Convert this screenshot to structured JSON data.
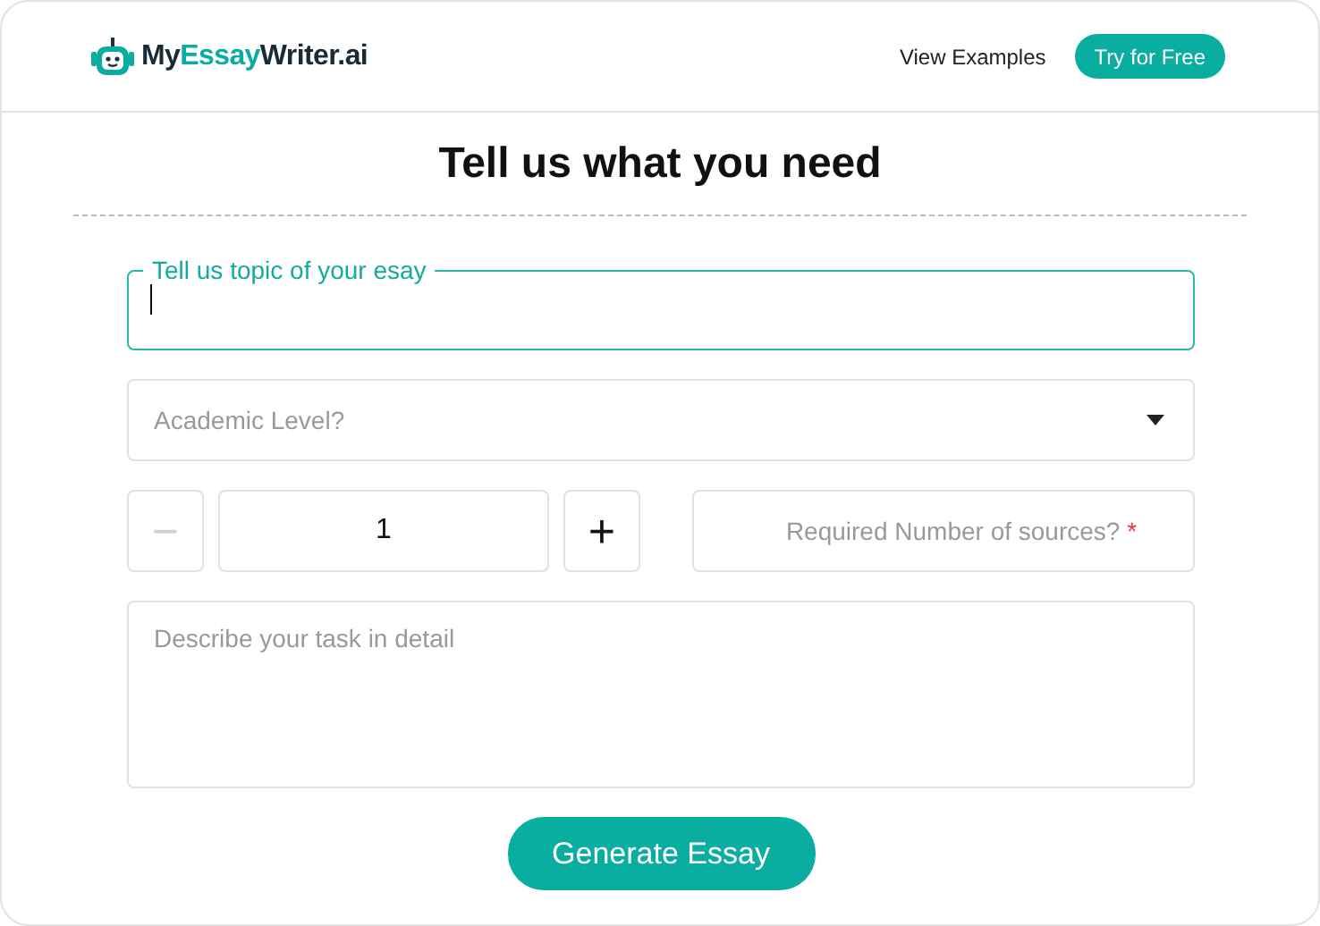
{
  "header": {
    "logo": [
      {
        "text": "My",
        "accent": false
      },
      {
        "text": "Essay",
        "accent": true
      },
      {
        "text": "Writer.ai",
        "accent": false
      }
    ],
    "nav_link": "View Examples",
    "cta": "Try for Free"
  },
  "title": "Tell us what you need",
  "topic": {
    "label": "Tell us topic of your esay",
    "focused": true
  },
  "academic_level": {
    "placeholder": "Academic Level?"
  },
  "sources": {
    "value": "1",
    "minus_disabled": true,
    "minus": "−",
    "plus": "+",
    "placeholder": "Required Number of sources?",
    "required_mark": "*"
  },
  "details": {
    "placeholder": "Describe your task in detail"
  },
  "submit": "Generate Essay"
}
